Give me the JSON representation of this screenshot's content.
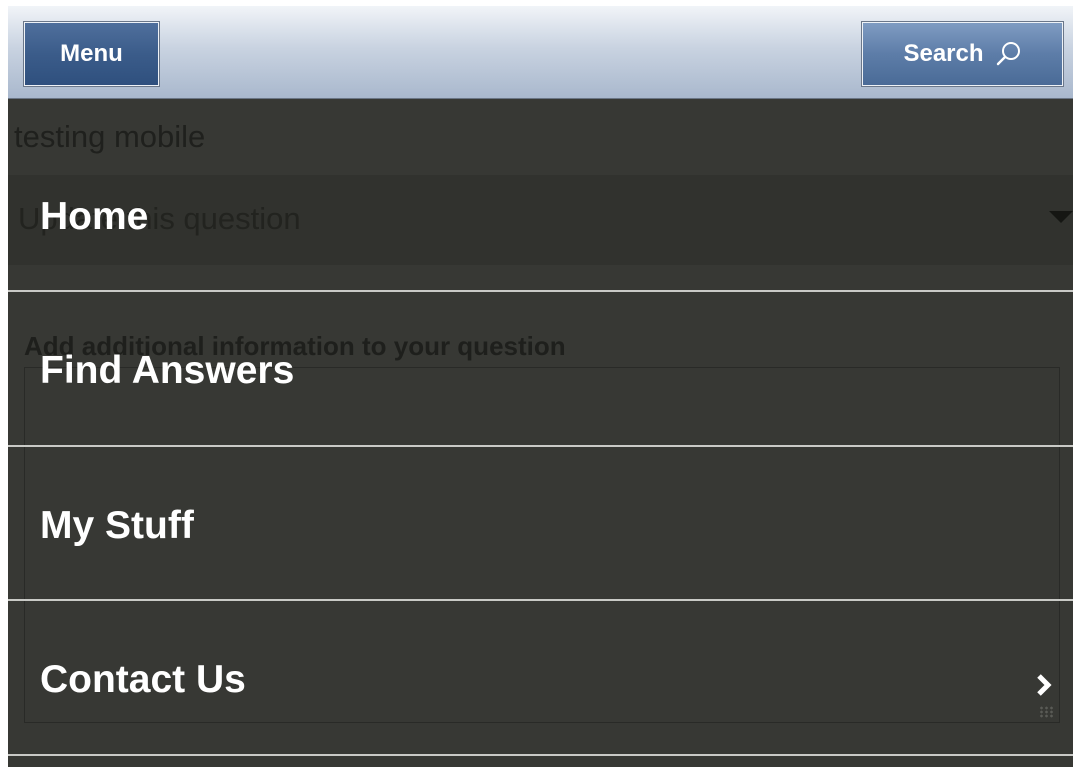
{
  "header": {
    "menu_label": "Menu",
    "search_label": "Search",
    "search_icon": "search-icon"
  },
  "background_page": {
    "title": "testing mobile",
    "dropdown_value": "Update this question",
    "dropdown_icon": "caret-down-icon",
    "additional_info_label": "Add additional information to your question"
  },
  "menu": {
    "items": [
      {
        "label": "Home"
      },
      {
        "label": "Find Answers"
      },
      {
        "label": "My Stuff"
      },
      {
        "label": "Contact Us",
        "icon": "chevron-right-icon"
      }
    ]
  },
  "colors": {
    "overlay": "#373834",
    "header_button": "#5d7da8",
    "menu_text": "#ffffff",
    "divider": "#c9cac6"
  }
}
